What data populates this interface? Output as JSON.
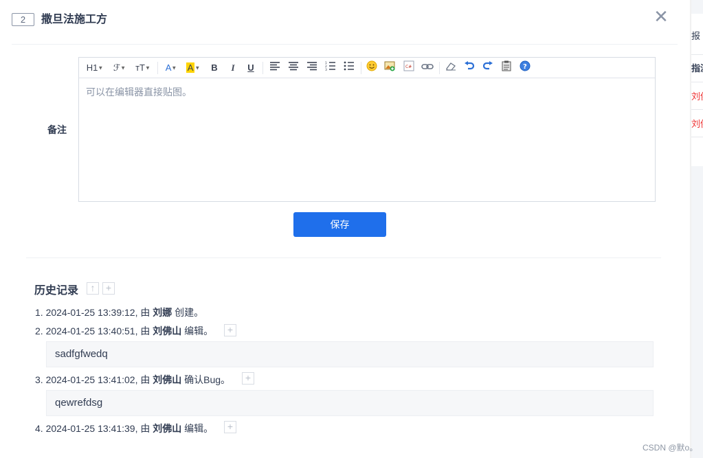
{
  "background": {
    "row1": "报",
    "row2": "指派",
    "row3": "刘佛",
    "row4": "刘佛"
  },
  "dialog": {
    "id": "2",
    "title": "撒旦法施工方",
    "close_icon": "close-icon"
  },
  "form": {
    "note_label": "备注",
    "editor_placeholder": "可以在编辑器直接贴图。",
    "save_label": "保存"
  },
  "toolbar": {
    "heading": "H1",
    "font_family": "ℱ",
    "font_size": "тT",
    "font_color": "A",
    "bg_color": "A",
    "bold": "B",
    "italic": "I",
    "underline": "U",
    "icons": [
      "align-left-icon",
      "align-center-icon",
      "align-right-icon",
      "ordered-list-icon",
      "unordered-list-icon",
      "emoticon-icon",
      "image-icon",
      "code-icon",
      "link-icon",
      "eraser-icon",
      "undo-icon",
      "redo-icon",
      "paste-icon",
      "help-icon"
    ]
  },
  "history": {
    "title": "历史记录",
    "items": [
      {
        "prefix": "1. 2024-01-25 13:39:12, 由 ",
        "user": "刘娜",
        "action": " 创建。"
      },
      {
        "prefix": "2. 2024-01-25 13:40:51, 由 ",
        "user": "刘佛山",
        "action": " 编辑。",
        "detail": "sadfgfwedq"
      },
      {
        "prefix": "3. 2024-01-25 13:41:02, 由 ",
        "user": "刘佛山",
        "action": " 确认Bug。",
        "detail": "qewrefdsg"
      },
      {
        "prefix": "4. 2024-01-25 13:41:39, 由 ",
        "user": "刘佛山",
        "action": " 编辑。"
      }
    ]
  },
  "watermark": "CSDN @默o。"
}
